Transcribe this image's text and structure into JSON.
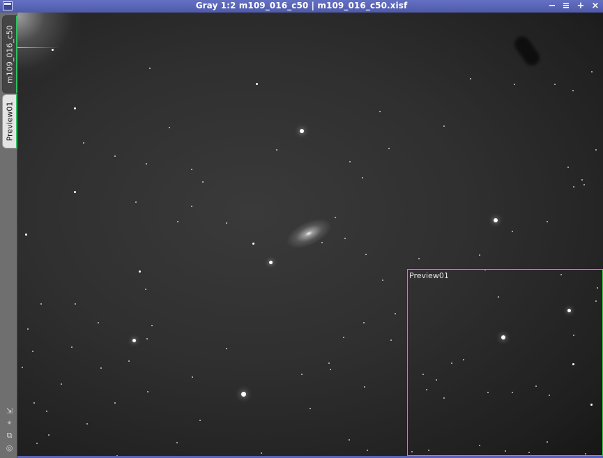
{
  "window": {
    "title": "Gray 1:2 m109_016_c50 | m109_016_c50.xisf",
    "controls": {
      "minimize": "−",
      "shade": "≡",
      "maximize": "+",
      "close": "×"
    },
    "accent_color": "#5a64b4"
  },
  "sidebar": {
    "tabs": [
      {
        "label": "m109_016_c50",
        "active": true
      },
      {
        "label": "Preview01",
        "active": false
      }
    ],
    "tools": [
      {
        "icon": "fit-view-icon",
        "glyph": "⇲"
      },
      {
        "icon": "zoom-fit-icon",
        "glyph": "⌖"
      },
      {
        "icon": "clone-icon",
        "glyph": "⧉"
      },
      {
        "icon": "settings-icon",
        "glyph": "◎"
      }
    ]
  },
  "image": {
    "preview": {
      "label": "Preview01",
      "border_color": "#3ed84a"
    }
  }
}
